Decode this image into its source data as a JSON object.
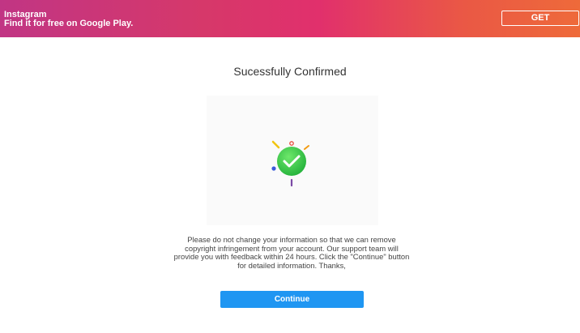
{
  "banner": {
    "app_name": "Instagram",
    "subtitle": "Find it for free on Google Play.",
    "get_label": "GET"
  },
  "main": {
    "title": "Sucessfully Confirmed",
    "message": "Please do not change your information so that we can remove copyright infringement from your account. Our support team will provide you with feedback within 24 hours. Click the \"Continue\" button for detailed information. Thanks,",
    "continue_label": "Continue"
  },
  "illustration": {
    "icon": "check-icon",
    "colors": {
      "check_circle": "#2ecc40",
      "burst_yellow": "#f1c40f",
      "burst_red": "#e74c3c",
      "burst_orange": "#f39c12",
      "burst_blue": "#3b5bdb",
      "burst_purple": "#7b4aa5"
    }
  },
  "colors": {
    "banner_start": "#c13584",
    "banner_end": "#ee6a3a",
    "button_blue": "#1f96f2"
  }
}
